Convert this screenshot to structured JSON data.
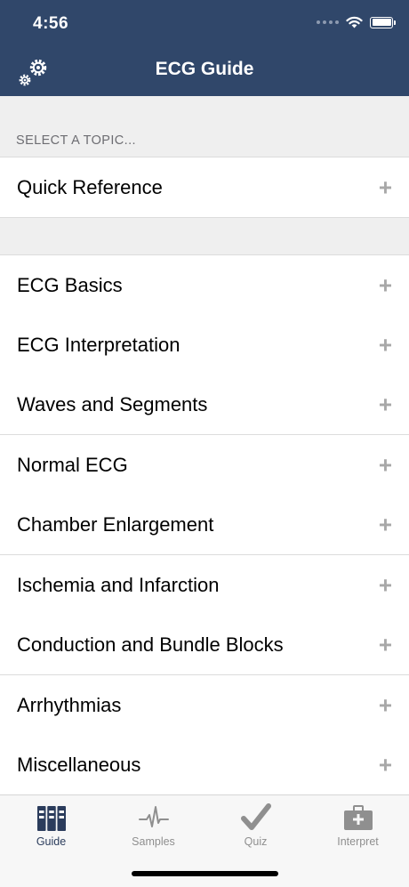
{
  "status": {
    "time": "4:56"
  },
  "nav": {
    "title": "ECG Guide"
  },
  "section": {
    "header": "SELECT A TOPIC..."
  },
  "quick": {
    "label": "Quick Reference"
  },
  "topics": [
    {
      "label": "ECG Basics"
    },
    {
      "label": "ECG Interpretation"
    },
    {
      "label": "Waves and Segments"
    },
    {
      "label": "Normal ECG"
    },
    {
      "label": "Chamber Enlargement"
    },
    {
      "label": "Ischemia and Infarction"
    },
    {
      "label": "Conduction and Bundle Blocks"
    },
    {
      "label": "Arrhythmias"
    },
    {
      "label": "Miscellaneous"
    }
  ],
  "expand_glyph": "+",
  "tabs": [
    {
      "label": "Guide",
      "icon": "books-icon",
      "active": true
    },
    {
      "label": "Samples",
      "icon": "pulse-icon",
      "active": false
    },
    {
      "label": "Quiz",
      "icon": "checkmark-icon",
      "active": false
    },
    {
      "label": "Interpret",
      "icon": "medical-kit-icon",
      "active": false
    }
  ],
  "colors": {
    "header": "#30476a",
    "active_tab": "#2b3c5c",
    "inactive_tab": "#8f8f8f"
  }
}
